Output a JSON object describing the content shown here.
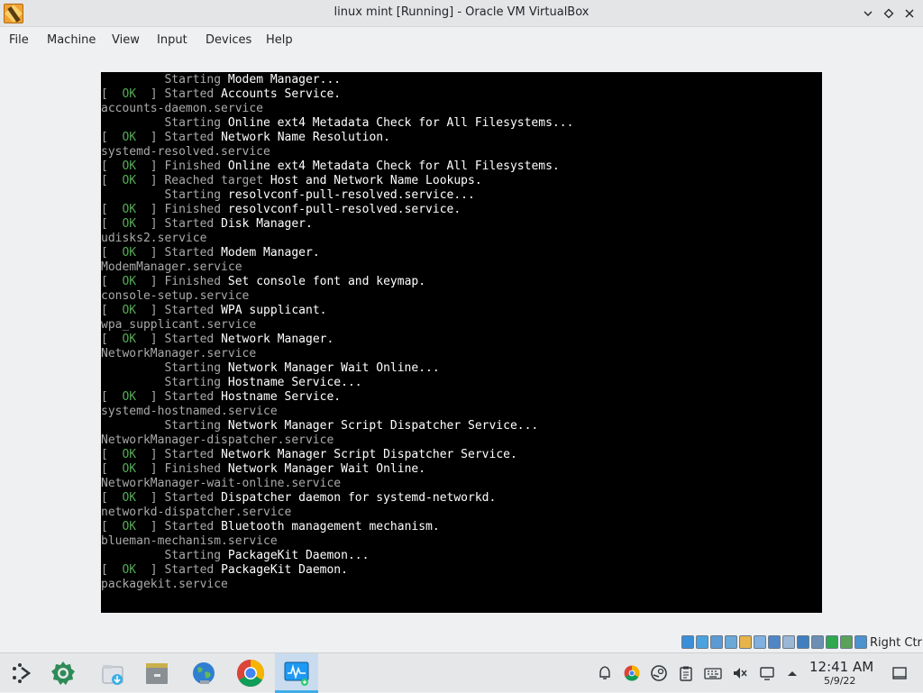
{
  "window": {
    "title": "linux mint [Running] - Oracle VM VirtualBox"
  },
  "menu": [
    "File",
    "Machine",
    "View",
    "Input",
    "Devices",
    "Help"
  ],
  "console": {
    "lines": [
      {
        "status": "",
        "text": "         Starting ",
        "target": "Modem Manager..."
      },
      {
        "status": "OK",
        "text": "Started ",
        "target": "Accounts Service."
      },
      {
        "status": "",
        "text": "accounts-daemon.service",
        "target": ""
      },
      {
        "status": "",
        "text": "         Starting ",
        "target": "Online ext4 Metadata Check for All Filesystems..."
      },
      {
        "status": "OK",
        "text": "Started ",
        "target": "Network Name Resolution."
      },
      {
        "status": "",
        "text": "systemd-resolved.service",
        "target": ""
      },
      {
        "status": "OK",
        "text": "Finished ",
        "target": "Online ext4 Metadata Check for All Filesystems."
      },
      {
        "status": "OK",
        "text": "Reached target ",
        "target": "Host and Network Name Lookups."
      },
      {
        "status": "",
        "text": "         Starting ",
        "target": "resolvconf-pull-resolved.service..."
      },
      {
        "status": "OK",
        "text": "Finished ",
        "target": "resolvconf-pull-resolved.service."
      },
      {
        "status": "OK",
        "text": "Started ",
        "target": "Disk Manager."
      },
      {
        "status": "",
        "text": "udisks2.service",
        "target": ""
      },
      {
        "status": "OK",
        "text": "Started ",
        "target": "Modem Manager."
      },
      {
        "status": "",
        "text": "ModemManager.service",
        "target": ""
      },
      {
        "status": "OK",
        "text": "Finished ",
        "target": "Set console font and keymap."
      },
      {
        "status": "",
        "text": "console-setup.service",
        "target": ""
      },
      {
        "status": "OK",
        "text": "Started ",
        "target": "WPA supplicant."
      },
      {
        "status": "",
        "text": "wpa_supplicant.service",
        "target": ""
      },
      {
        "status": "OK",
        "text": "Started ",
        "target": "Network Manager."
      },
      {
        "status": "",
        "text": "NetworkManager.service",
        "target": ""
      },
      {
        "status": "",
        "text": "         Starting ",
        "target": "Network Manager Wait Online..."
      },
      {
        "status": "",
        "text": "         Starting ",
        "target": "Hostname Service..."
      },
      {
        "status": "OK",
        "text": "Started ",
        "target": "Hostname Service."
      },
      {
        "status": "",
        "text": "systemd-hostnamed.service",
        "target": ""
      },
      {
        "status": "",
        "text": "         Starting ",
        "target": "Network Manager Script Dispatcher Service..."
      },
      {
        "status": "",
        "text": "NetworkManager-dispatcher.service",
        "target": ""
      },
      {
        "status": "OK",
        "text": "Started ",
        "target": "Network Manager Script Dispatcher Service."
      },
      {
        "status": "OK",
        "text": "Finished ",
        "target": "Network Manager Wait Online."
      },
      {
        "status": "",
        "text": "NetworkManager-wait-online.service",
        "target": ""
      },
      {
        "status": "OK",
        "text": "Started ",
        "target": "Dispatcher daemon for systemd-networkd."
      },
      {
        "status": "",
        "text": "networkd-dispatcher.service",
        "target": ""
      },
      {
        "status": "OK",
        "text": "Started ",
        "target": "Bluetooth management mechanism."
      },
      {
        "status": "",
        "text": "blueman-mechanism.service",
        "target": ""
      },
      {
        "status": "",
        "text": "         Starting ",
        "target": "PackageKit Daemon..."
      },
      {
        "status": "OK",
        "text": "Started ",
        "target": "PackageKit Daemon."
      },
      {
        "status": "",
        "text": "packagekit.service",
        "target": ""
      }
    ]
  },
  "status_bar": {
    "host_key": "Right Ctrl",
    "icons": [
      "optical-drive-icon",
      "audio-icon",
      "network-icon",
      "usb-icon",
      "shared-folders-icon",
      "pencil-icon",
      "display-icon",
      "recording-icon",
      "vm-window-icon",
      "cpu-icon",
      "guest-additions-icon",
      "mouse-integration-icon",
      "keyboard-capture-icon"
    ]
  },
  "taskbar": {
    "apps": [
      "application-launcher-icon",
      "settings-icon",
      "downloads-icon",
      "files-icon",
      "browser-globe-icon",
      "chrome-icon",
      "system-monitor-icon"
    ],
    "tray": [
      "notifications-icon",
      "chrome-tray-icon",
      "steam-icon",
      "clipboard-icon",
      "keyboard-icon",
      "volume-muted-icon",
      "display-tray-icon",
      "show-more-icon"
    ],
    "time": "12:41 AM",
    "date": "5/9/22"
  }
}
